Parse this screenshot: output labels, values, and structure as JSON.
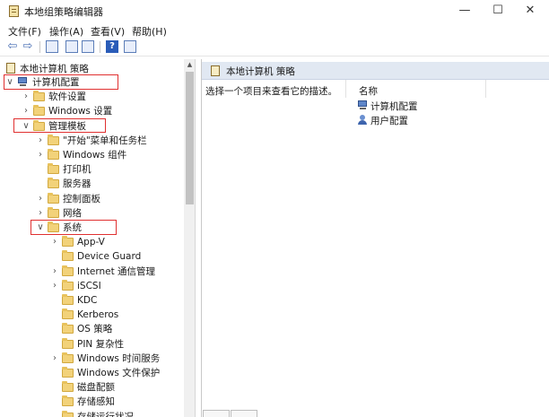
{
  "window": {
    "title": "本地组策略编辑器",
    "controls": {
      "minimize": "—",
      "maximize": "☐",
      "close": "✕"
    }
  },
  "menu": [
    "文件(F)",
    "操作(A)",
    "查看(V)",
    "帮助(H)"
  ],
  "toolbar": {
    "back": "⇦",
    "forward": "⇨",
    "help": "?"
  },
  "tree": {
    "root": "本地计算机 策略",
    "items": [
      {
        "label": "计算机配置",
        "arrow": "∨",
        "level": 0,
        "icon": "computer-icon"
      },
      {
        "label": "软件设置",
        "arrow": "›",
        "level": 1,
        "icon": "folder-icon"
      },
      {
        "label": "Windows 设置",
        "arrow": "›",
        "level": 1,
        "icon": "folder-icon"
      },
      {
        "label": "管理模板",
        "arrow": "∨",
        "level": 1,
        "icon": "folder-icon"
      },
      {
        "label": "\"开始\"菜单和任务栏",
        "arrow": "›",
        "level": 2,
        "icon": "folder-icon"
      },
      {
        "label": "Windows 组件",
        "arrow": "›",
        "level": 2,
        "icon": "folder-icon"
      },
      {
        "label": "打印机",
        "arrow": "",
        "level": 2,
        "icon": "folder-icon"
      },
      {
        "label": "服务器",
        "arrow": "",
        "level": 2,
        "icon": "folder-icon"
      },
      {
        "label": "控制面板",
        "arrow": "›",
        "level": 2,
        "icon": "folder-icon"
      },
      {
        "label": "网络",
        "arrow": "›",
        "level": 2,
        "icon": "folder-icon"
      },
      {
        "label": "系统",
        "arrow": "∨",
        "level": 2,
        "icon": "folder-icon"
      },
      {
        "label": "App-V",
        "arrow": "›",
        "level": 3,
        "icon": "folder-icon"
      },
      {
        "label": "Device Guard",
        "arrow": "",
        "level": 3,
        "icon": "folder-icon"
      },
      {
        "label": "Internet 通信管理",
        "arrow": "›",
        "level": 3,
        "icon": "folder-icon"
      },
      {
        "label": "iSCSI",
        "arrow": "›",
        "level": 3,
        "icon": "folder-icon"
      },
      {
        "label": "KDC",
        "arrow": "",
        "level": 3,
        "icon": "folder-icon"
      },
      {
        "label": "Kerberos",
        "arrow": "",
        "level": 3,
        "icon": "folder-icon"
      },
      {
        "label": "OS 策略",
        "arrow": "",
        "level": 3,
        "icon": "folder-icon"
      },
      {
        "label": "PIN 复杂性",
        "arrow": "",
        "level": 3,
        "icon": "folder-icon"
      },
      {
        "label": "Windows 时间服务",
        "arrow": "›",
        "level": 3,
        "icon": "folder-icon"
      },
      {
        "label": "Windows 文件保护",
        "arrow": "",
        "level": 3,
        "icon": "folder-icon"
      },
      {
        "label": "磁盘配额",
        "arrow": "",
        "level": 3,
        "icon": "folder-icon"
      },
      {
        "label": "存储感知",
        "arrow": "",
        "level": 3,
        "icon": "folder-icon"
      },
      {
        "label": "存储运行状况",
        "arrow": "",
        "level": 3,
        "icon": "folder-icon"
      }
    ]
  },
  "details": {
    "header": "本地计算机 策略",
    "description": "选择一个项目来查看它的描述。",
    "column_name": "名称",
    "items": [
      {
        "label": "计算机配置",
        "icon": "computer-icon"
      },
      {
        "label": "用户配置",
        "icon": "user-icon"
      }
    ]
  },
  "colors": {
    "highlight": "#e03030",
    "header_bg": "#e1e8f2",
    "folder": "#f2d27a"
  }
}
